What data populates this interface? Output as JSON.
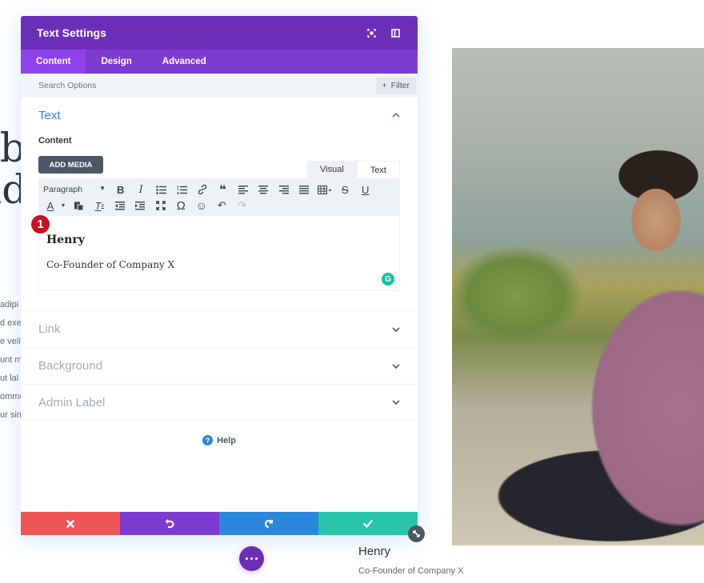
{
  "background": {
    "heading_lines": [
      "ab",
      "nd"
    ],
    "body_lines": [
      "adipi",
      "d exer",
      "e velit",
      "unt m",
      "ut lal",
      "ommo",
      "ur sint"
    ],
    "caption_name": "Henry",
    "caption_title": "Co-Founder of Company X",
    "photo_alt": "portrait photo"
  },
  "modal": {
    "title": "Text Settings",
    "header_icons": [
      "focus-mode-icon",
      "split-view-icon"
    ],
    "tabs": [
      {
        "label": "Content",
        "active": true
      },
      {
        "label": "Design",
        "active": false
      },
      {
        "label": "Advanced",
        "active": false
      }
    ],
    "search": {
      "placeholder": "Search Options",
      "value": ""
    },
    "filter_label": "Filter",
    "text_section": {
      "title": "Text",
      "content_label": "Content",
      "add_media_label": "ADD MEDIA",
      "editor_tabs": [
        {
          "label": "Visual",
          "active": true
        },
        {
          "label": "Text",
          "active": false
        }
      ],
      "format_select": "Paragraph",
      "toolbar_row1": [
        "bold",
        "italic",
        "bullet-list",
        "numbered-list",
        "link",
        "blockquote",
        "align-left",
        "align-center",
        "align-right",
        "align-justify",
        "table",
        "strikethrough",
        "underline"
      ],
      "toolbar_row2": [
        "text-color",
        "paste-as-text",
        "clear-formatting",
        "outdent",
        "indent",
        "fullscreen",
        "special-character",
        "emoji",
        "undo",
        "redo"
      ],
      "body_name": "Henry",
      "body_title": "Co-Founder of Company X",
      "step_badge": "1"
    },
    "closed_sections": [
      "Link",
      "Background",
      "Admin Label"
    ],
    "help_label": "Help"
  },
  "footer": {
    "buttons": [
      {
        "name": "cancel",
        "color": "#ef5555"
      },
      {
        "name": "undo",
        "color": "#7e3bd0"
      },
      {
        "name": "redo",
        "color": "#2b87da"
      },
      {
        "name": "save",
        "color": "#29c4a9"
      }
    ]
  },
  "colors": {
    "header": "#6c2eb9",
    "tabs": "#7e3bd0",
    "active_tab": "#8f42ec",
    "accent_blue": "#2b87da",
    "badge_red": "#c8101e"
  }
}
